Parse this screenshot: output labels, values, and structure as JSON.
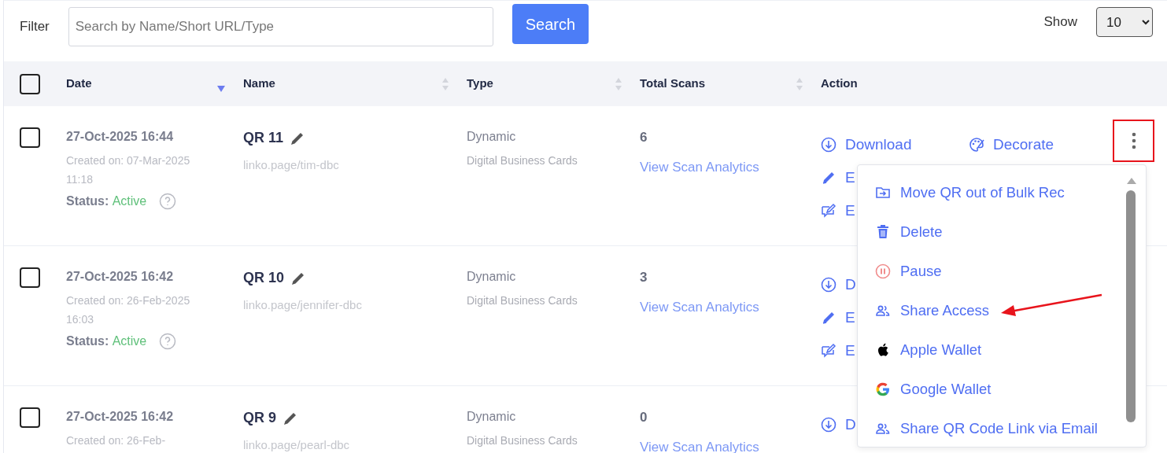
{
  "filter": {
    "label": "Filter",
    "placeholder": "Search by Name/Short URL/Type",
    "button": "Search"
  },
  "show": {
    "label": "Show",
    "value": "10"
  },
  "table": {
    "select_all": {
      "checked": false
    },
    "columns": [
      {
        "label": "Date",
        "sorted": true
      },
      {
        "label": "Name",
        "sorted": false
      },
      {
        "label": "Type",
        "sorted": false
      },
      {
        "label": "Total Scans",
        "sorted": false
      },
      {
        "label": "Action"
      }
    ],
    "rows": [
      {
        "checked": false,
        "date": "27-Oct-2025 16:44",
        "created": "Created on: 07-Mar-2025 11:18",
        "status_label": "Status:",
        "status": "Active",
        "name": "QR 11",
        "url": "linko.page/tim-dbc",
        "type": "Dynamic",
        "category": "Digital Business Cards",
        "scans": "6",
        "analytics": "View Scan Analytics",
        "actions": [
          {
            "kind": "download",
            "label": "Download"
          },
          {
            "kind": "decorate",
            "label": "Decorate"
          },
          {
            "kind": "edit",
            "label": "E"
          },
          {
            "kind": "email",
            "label": "E"
          }
        ],
        "more": {
          "highlighted": true,
          "expanded": true
        }
      },
      {
        "checked": false,
        "date": "27-Oct-2025 16:42",
        "created": "Created on: 26-Feb-2025 16:03",
        "status_label": "Status:",
        "status": "Active",
        "name": "QR 10",
        "url": "linko.page/jennifer-dbc",
        "type": "Dynamic",
        "category": "Digital Business Cards",
        "scans": "3",
        "analytics": "View Scan Analytics",
        "actions": [
          {
            "kind": "download",
            "label": "D"
          },
          {
            "kind": "edit",
            "label": "E"
          },
          {
            "kind": "email",
            "label": "E"
          }
        ]
      },
      {
        "checked": false,
        "date": "27-Oct-2025 16:42",
        "created": "Created on: 26-Feb-",
        "name": "QR 9",
        "url": "linko.page/pearl-dbc",
        "type": "Dynamic",
        "category": "Digital Business Cards",
        "scans": "0",
        "analytics": "View Scan Analytics",
        "actions": [
          {
            "kind": "download",
            "label": "D"
          }
        ]
      }
    ]
  },
  "menu": {
    "items": [
      {
        "kind": "move",
        "label": "Move QR out of Bulk Rec",
        "pointed": false
      },
      {
        "kind": "delete",
        "label": "Delete",
        "pointed": false
      },
      {
        "kind": "pause",
        "label": "Pause",
        "pointed": false
      },
      {
        "kind": "share",
        "label": "Share Access",
        "pointed": true
      },
      {
        "kind": "apple",
        "label": "Apple Wallet",
        "pointed": false
      },
      {
        "kind": "google",
        "label": "Google Wallet",
        "pointed": false
      },
      {
        "kind": "share",
        "label": "Share QR Code Link via Email",
        "pointed": false
      }
    ]
  }
}
